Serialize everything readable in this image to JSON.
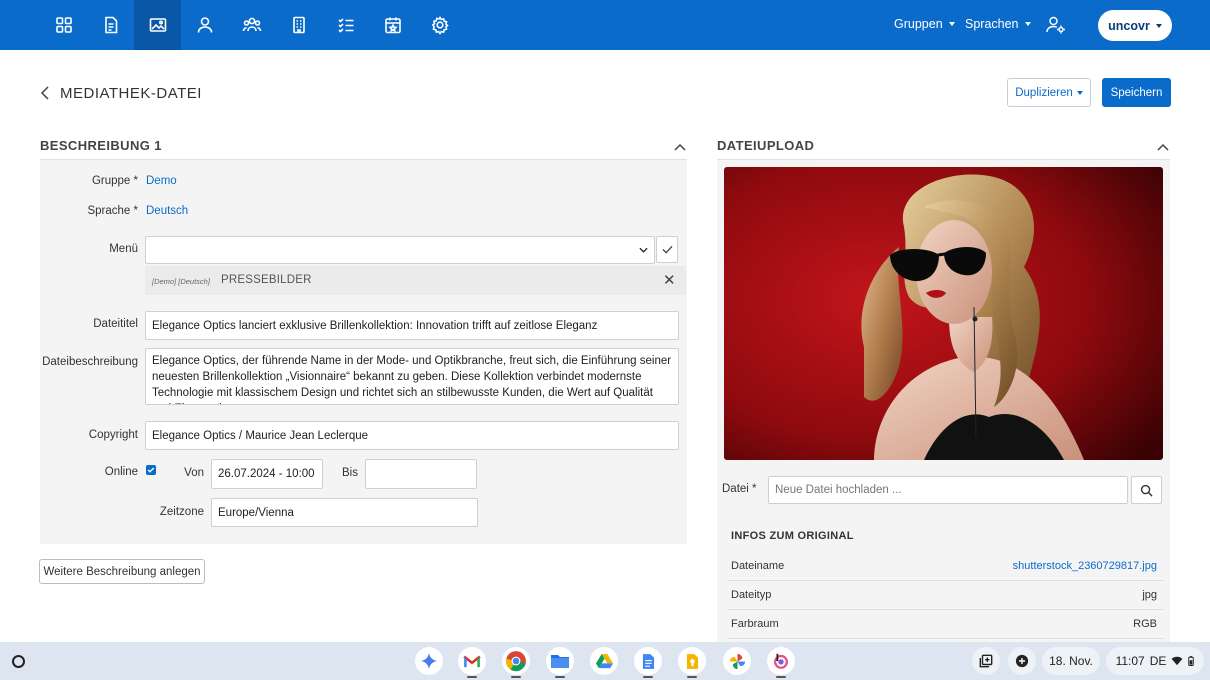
{
  "nav": {
    "icons": [
      "dashboard-icon",
      "document-icon",
      "image-icon",
      "user-icon",
      "users-icon",
      "building-icon",
      "checklist-icon",
      "calendar-icon",
      "gear-icon"
    ],
    "active_index": 2,
    "groups_label": "Gruppen",
    "languages_label": "Sprachen",
    "user_button": "uncovr"
  },
  "header": {
    "title": "MEDIATHEK-DATEI",
    "duplicate_label": "Duplizieren",
    "save_label": "Speichern"
  },
  "description": {
    "section_title": "BESCHREIBUNG 1",
    "group_label": "Gruppe *",
    "group_value": "Demo",
    "language_label": "Sprache *",
    "language_value": "Deutsch",
    "menu_label": "Menü",
    "menu_value": "",
    "menu_tag_context": "[Demo] [Deutsch]",
    "menu_tag_name": "PRESSEBILDER",
    "title_label": "Dateititel",
    "title_value": "Elegance Optics lanciert exklusive Brillenkollektion: Innovation trifft auf zeitlose Eleganz",
    "desc_label": "Dateibeschreibung",
    "desc_value": "Elegance Optics, der führende Name in der Mode- und Optikbranche, freut sich, die Einführung seiner neuesten Brillenkollektion „Visionnaire“ bekannt zu geben. Diese Kollektion verbindet modernste Technologie mit klassischem Design und richtet sich an stilbewusste Kunden, die Wert auf Qualität und Eleganz legen.",
    "copyright_label": "Copyright",
    "copyright_value": "Elegance Optics / Maurice Jean Leclerque",
    "online_label": "Online",
    "online_checked": true,
    "from_label": "Von",
    "from_value": "26.07.2024 - 10:00",
    "to_label": "Bis",
    "to_value": "",
    "timezone_label": "Zeitzone",
    "timezone_value": "Europe/Vienna",
    "add_description_button": "Weitere Beschreibung anlegen"
  },
  "upload": {
    "section_title": "DATEIUPLOAD",
    "file_label": "Datei *",
    "file_placeholder": "Neue Datei hochladen ...",
    "info_title": "INFOS ZUM ORIGINAL",
    "info": [
      {
        "key": "Dateiname",
        "value": "shutterstock_2360729817.jpg",
        "link": true
      },
      {
        "key": "Dateityp",
        "value": "jpg",
        "link": false
      },
      {
        "key": "Farbraum",
        "value": "RGB",
        "link": false
      }
    ]
  },
  "taskbar": {
    "apps": [
      "gemini-icon",
      "gmail-icon",
      "chrome-icon",
      "files-icon",
      "drive-icon",
      "docs-icon",
      "keep-icon",
      "photos-icon",
      "app-icon"
    ],
    "date": "18. Nov.",
    "time": "11:07",
    "locale": "DE"
  },
  "colors": {
    "brand": "#0b6bcb",
    "panel": "#f4f4f5"
  }
}
